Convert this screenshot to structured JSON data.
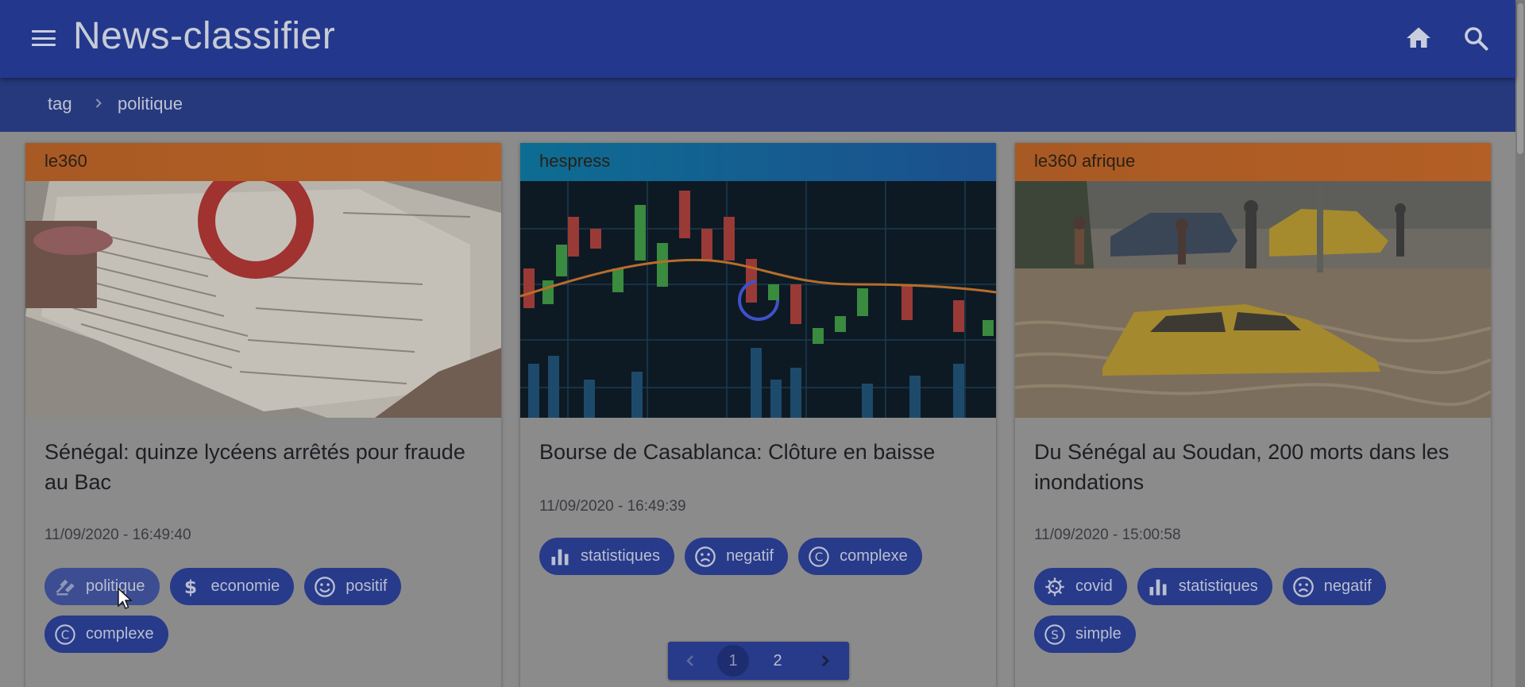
{
  "app": {
    "title": "News-classifier",
    "menu_icon": "menu-icon",
    "home_icon": "home-icon",
    "search_icon": "search-icon"
  },
  "breadcrumb": {
    "items": [
      "tag",
      "politique"
    ]
  },
  "articles": [
    {
      "source": "le360",
      "source_color": "#b35f25",
      "title": "Sénégal: quinze lycéens arrêtés pour fraude au Bac",
      "date": "11/09/2020 - 16:49:40",
      "tags": [
        {
          "label": "politique",
          "icon": "gavel-icon"
        },
        {
          "label": "economie",
          "icon": "dollar-icon"
        },
        {
          "label": "positif",
          "icon": "smile-icon"
        },
        {
          "label": "complexe",
          "icon": "copyright-c-icon"
        }
      ]
    },
    {
      "source": "hespress",
      "source_color": "#0d6d93",
      "title": "Bourse de Casablanca: Clôture en baisse",
      "date": "11/09/2020 - 16:49:39",
      "tags": [
        {
          "label": "statistiques",
          "icon": "bar-chart-icon"
        },
        {
          "label": "negatif",
          "icon": "sad-face-icon"
        },
        {
          "label": "complexe",
          "icon": "copyright-c-icon"
        }
      ]
    },
    {
      "source": "le360 afrique",
      "source_color": "#b35f25",
      "title": "Du Sénégal au Soudan, 200 morts dans les inondations",
      "date": "11/09/2020 - 15:00:58",
      "tags": [
        {
          "label": "covid",
          "icon": "virus-icon"
        },
        {
          "label": "statistiques",
          "icon": "bar-chart-icon"
        },
        {
          "label": "negatif",
          "icon": "sad-face-icon"
        },
        {
          "label": "simple",
          "icon": "s-circle-icon"
        }
      ]
    }
  ],
  "pagination": {
    "pages": [
      "1",
      "2"
    ],
    "current_page": 1
  },
  "colors": {
    "appbar": "#23388c",
    "chip": "#283a8a",
    "overlay": "#8b8b8b"
  }
}
